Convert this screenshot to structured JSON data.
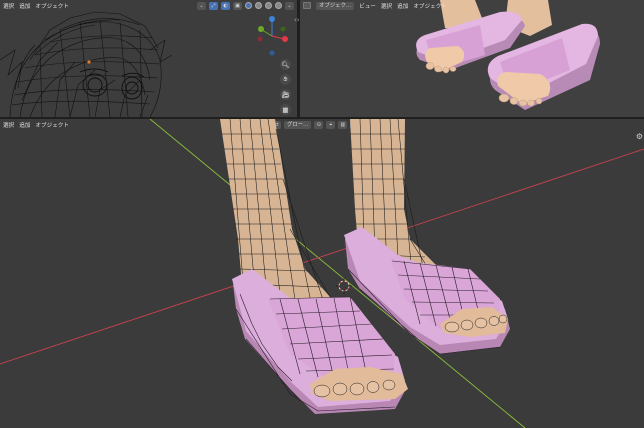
{
  "top_left_header": {
    "menus": [
      "選択",
      "追加",
      "オブジェクト"
    ]
  },
  "top_right_header": {
    "mode_dropdown": "オブジェク...",
    "menus": [
      "ビュー",
      "選択",
      "追加",
      "オブジェクト"
    ]
  },
  "bottom_header": {
    "menus": [
      "選択",
      "追加",
      "オブジェクト"
    ],
    "transform_orientation": "グロー..."
  },
  "gizmo": {
    "x_label": "X",
    "y_label": "Y",
    "z_label": "Z",
    "x_color": "#e4394a",
    "y_color": "#6dab23",
    "z_color": "#3b83d9"
  },
  "nav_buttons": [
    "zoom-icon",
    "hand-pan-icon",
    "camera-icon",
    "grid-view-icon"
  ],
  "colors": {
    "viewport_bg": "#3d3d3d",
    "sandal": "#d9a9dc",
    "skin": "#d9b596",
    "active_blue": "#4772b3"
  }
}
